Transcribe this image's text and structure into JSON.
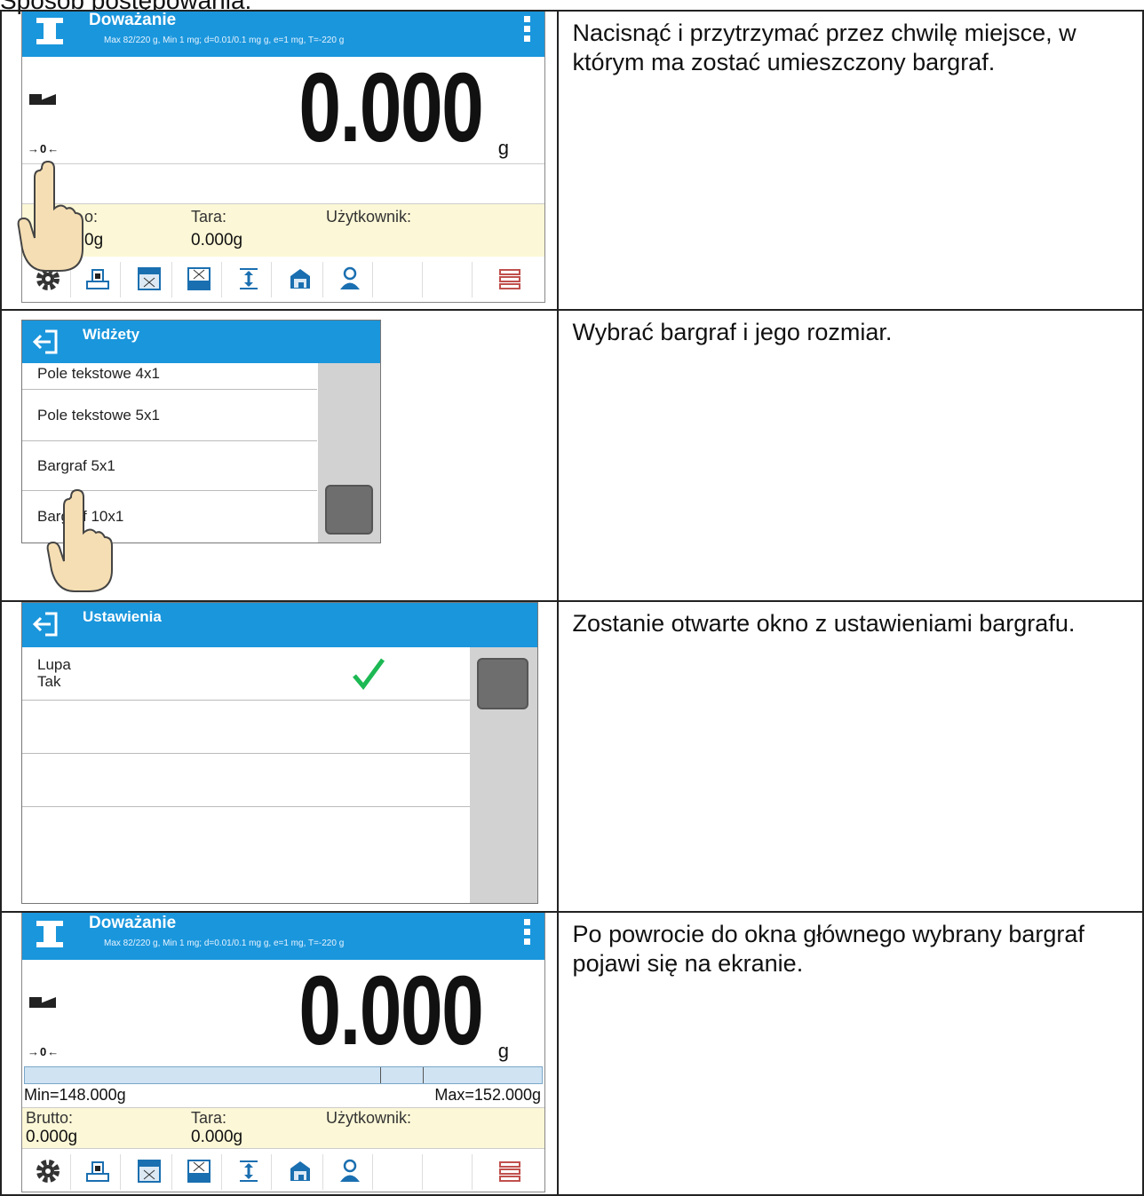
{
  "doc": {
    "heading": "Sposób postępowania:"
  },
  "steps": [
    {
      "text": "Nacisnąć i przytrzymać przez chwilę miejsce, w którym ma zostać umieszczony bargraf."
    },
    {
      "text": "Wybrać bargraf i jego rozmiar."
    },
    {
      "text": "Zostanie otwarte okno z ustawieniami bargrafu."
    },
    {
      "text": "Po powrocie do okna głównego wybrany bargraf pojawi się na ekranie."
    }
  ],
  "weigh": {
    "title": "Doważanie",
    "subtitle": "Max 82/220 g, Min 1 mg; d=0.01/0.1 mg g, e=1 mg, T=-220 g",
    "value": "0.000",
    "unit": "g",
    "zero_symbol": "→0←",
    "brutto_label": "Brutto:",
    "brutto_value": "0.000g",
    "brutto_label_partial": "o:",
    "brutto_value_partial": "0g",
    "tara_label": "Tara:",
    "tara_value": "0.000g",
    "user_label": "Użytkownik:",
    "user_value": "",
    "bar_min": "Min=148.000g",
    "bar_max": "Max=152.000g",
    "toolbar_icons": [
      "gear-icon",
      "weighing-icon",
      "table-icon",
      "grid-icon",
      "height-icon",
      "tare-container-icon",
      "user-icon",
      "empty",
      "empty",
      "database-icon"
    ]
  },
  "widgets": {
    "title": "Widżety",
    "items": [
      "Pole tekstowe 4x1",
      "Pole tekstowe 5x1",
      "Bargraf 5x1",
      "Bargraf 10x1"
    ]
  },
  "settings": {
    "title": "Ustawienia",
    "item_label": "Lupa",
    "item_value": "Tak"
  },
  "colors": {
    "header": "#1a96dc",
    "infobar": "#fcf7d6",
    "check": "#1db954"
  }
}
